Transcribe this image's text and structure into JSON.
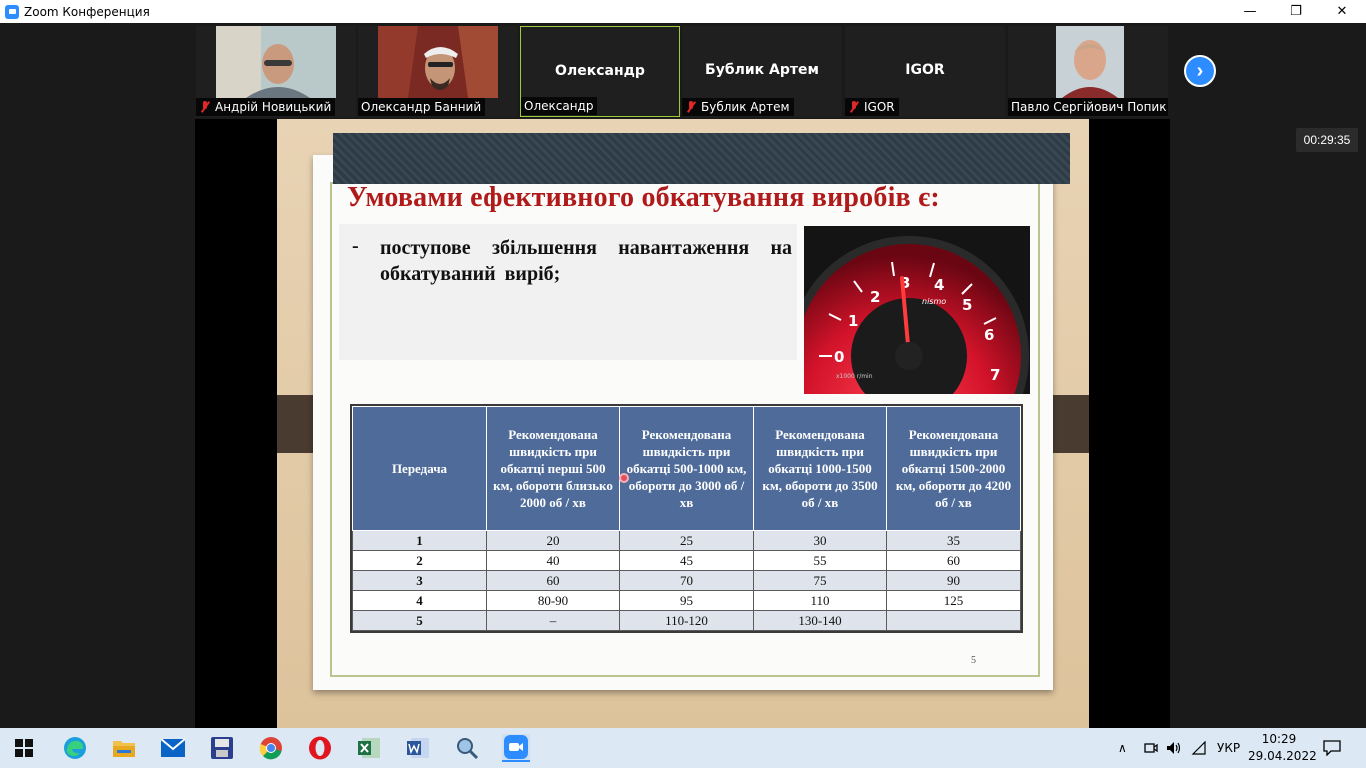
{
  "window": {
    "title": "Zoom Конференция",
    "minimize": "—",
    "restore": "❐",
    "close": "✕"
  },
  "participants": [
    {
      "name": "Андрій Новицький",
      "muted": true,
      "video": true
    },
    {
      "name": "Олександр Банний",
      "muted": false,
      "video": true
    },
    {
      "name": "Олександр",
      "display": "Олександр",
      "muted": false,
      "video": false,
      "active": true
    },
    {
      "name": "Бублик Артем",
      "display": "Бублик Артем",
      "muted": true,
      "video": false
    },
    {
      "name": "IGOR",
      "display": "IGOR",
      "muted": true,
      "video": false
    },
    {
      "name": "Павло Сергійович Попик",
      "muted": false,
      "video": true
    }
  ],
  "meeting_timer": "00:29:35",
  "slide": {
    "title": "Умовами ефективного обкатування виробів є:",
    "bullet_marker": "-",
    "bullet_text": "поступове збільшення навантаження на обкатуваний виріб;",
    "page_number": "5",
    "table": {
      "headers": [
        "Передача",
        "Рекомендована швидкість при обкатці перші 500 км, обороти близько 2000 об / хв",
        "Рекомендована швидкість при обкатці 500-1000 км, обороти до 3000 об / хв",
        "Рекомендована швидкість при обкатці 1000-1500 км, обороти до 3500 об / хв",
        "Рекомендована швидкість при обкатці 1500-2000 км, обороти до 4200 об / хв"
      ],
      "rows": [
        [
          "1",
          "20",
          "25",
          "30",
          "35"
        ],
        [
          "2",
          "40",
          "45",
          "55",
          "60"
        ],
        [
          "3",
          "60",
          "70",
          "75",
          "90"
        ],
        [
          "4",
          "80-90",
          "95",
          "110",
          "125"
        ],
        [
          "5",
          "–",
          "110-120",
          "130-140",
          ""
        ]
      ]
    },
    "gauge": {
      "numbers": [
        "0",
        "1",
        "2",
        "3",
        "4",
        "5",
        "6",
        "7"
      ],
      "brand": "nismo",
      "unit": "x1000 r/min"
    }
  },
  "taskbar": {
    "apps": [
      "windows-start",
      "edge",
      "file-explorer",
      "mail",
      "save-disk",
      "chrome",
      "opera",
      "excel",
      "word",
      "magnifier-search",
      "zoom"
    ],
    "language": "УКР",
    "time": "10:29",
    "date": "29.04.2022"
  },
  "colors": {
    "zoom_blue": "#2d8cff",
    "active_border": "#9ccc3a",
    "slide_title_red": "#b01a1a",
    "table_header_blue": "#4f6b99",
    "muted_red": "#e02828"
  }
}
